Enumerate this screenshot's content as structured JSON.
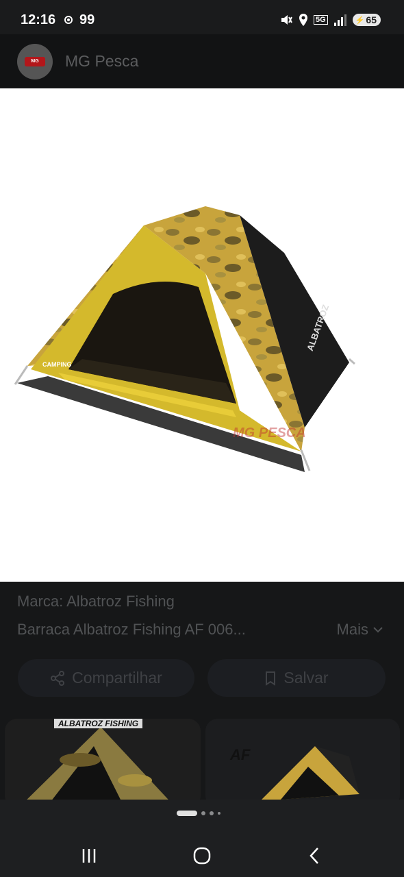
{
  "status": {
    "time": "12:16",
    "notif_count": "99",
    "battery": "65",
    "network": "5G"
  },
  "header": {
    "site_name": "MG Pesca",
    "logo_text": "MG"
  },
  "hero": {
    "tent_label": "ALBATROZ",
    "watermark": "MG PESCA",
    "brand_mark": "CAMPING"
  },
  "info": {
    "brand": "Marca: Albatroz Fishing",
    "title": "Barraca Albatroz Fishing AF 006...",
    "more_label": "Mais"
  },
  "actions": {
    "share_label": "Compartilhar",
    "save_label": "Salvar"
  },
  "thumbnails": [
    {
      "caption": "ALBATROZ FISHING"
    },
    {
      "caption": "AF"
    }
  ],
  "pager": {
    "count": 4,
    "active": 0
  },
  "icons": [
    "location-icon",
    "mute-icon",
    "signal-icon",
    "share-icon",
    "bookmark-icon",
    "chevron-down-icon",
    "recents-icon",
    "home-icon",
    "back-icon"
  ]
}
